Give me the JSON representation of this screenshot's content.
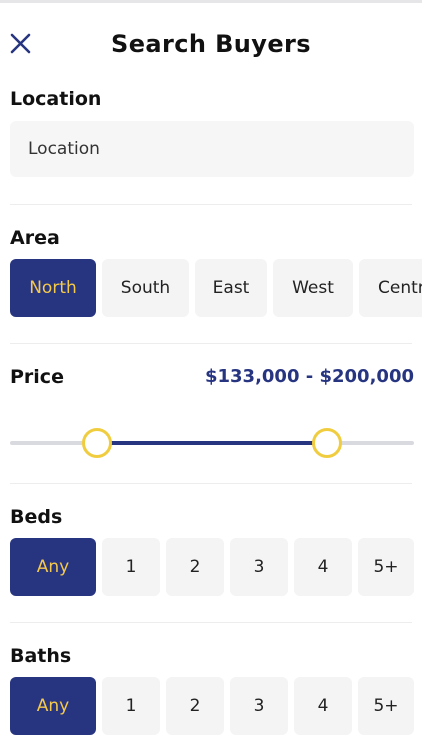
{
  "header": {
    "title": "Search Buyers",
    "close_icon": "close-icon"
  },
  "location": {
    "title": "Location",
    "placeholder": "Location"
  },
  "area": {
    "title": "Area",
    "options": [
      "North",
      "South",
      "East",
      "West",
      "Central"
    ],
    "selected": "North"
  },
  "price": {
    "title": "Price",
    "range_text": "$133,000 - $200,000",
    "slider": {
      "min_fraction": 0.215,
      "max_fraction": 0.785
    }
  },
  "beds": {
    "title": "Beds",
    "options": [
      "Any",
      "1",
      "2",
      "3",
      "4",
      "5+"
    ],
    "selected": "Any"
  },
  "baths": {
    "title": "Baths",
    "options": [
      "Any",
      "1",
      "2",
      "3",
      "4",
      "5+"
    ],
    "selected": "Any"
  },
  "colors": {
    "accent": "#273581",
    "highlight": "#f5c94a",
    "chip_bg": "#f4f4f5"
  }
}
